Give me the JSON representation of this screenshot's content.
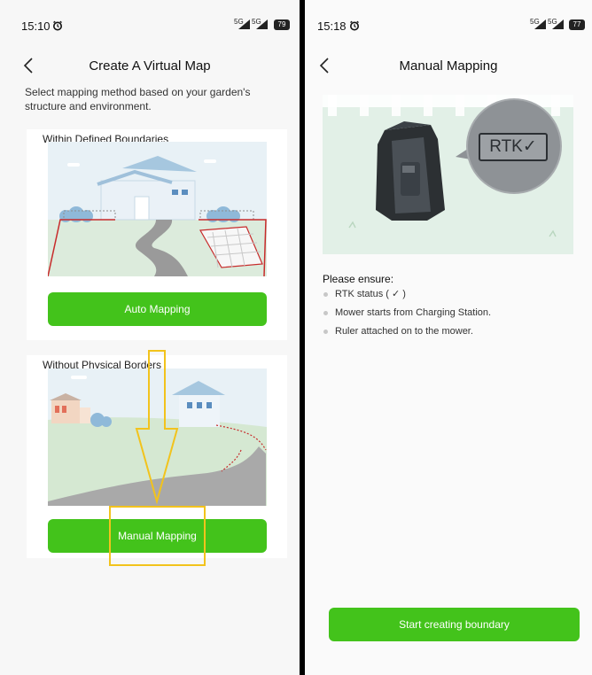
{
  "left": {
    "status_time": "15:10",
    "battery": "79",
    "title": "Create A Virtual Map",
    "description": "Select mapping method based on your garden's structure and environment.",
    "card1": {
      "title": "Within Defined Boundaries",
      "button": "Auto Mapping"
    },
    "card2": {
      "title": "Without Physical Borders",
      "button": "Manual Mapping"
    }
  },
  "right": {
    "status_time": "15:18",
    "battery": "77",
    "title": "Manual Mapping",
    "rtk_badge": "RTK✓",
    "ensure_heading": "Please ensure:",
    "bullets": [
      "RTK status ( ✓ )",
      "Mower starts from Charging Station.",
      "Ruler attached on to the mower."
    ],
    "start_button": "Start creating boundary"
  },
  "signal_label": "5G",
  "colors": {
    "accent_green": "#43c31b",
    "annotation_yellow": "#f2c31c",
    "sky": "#e8f1f6",
    "grass": "#dcebdc"
  },
  "icons": [
    "alarm-icon",
    "signal-icon",
    "battery-icon",
    "back-chevron-icon",
    "check-icon"
  ]
}
